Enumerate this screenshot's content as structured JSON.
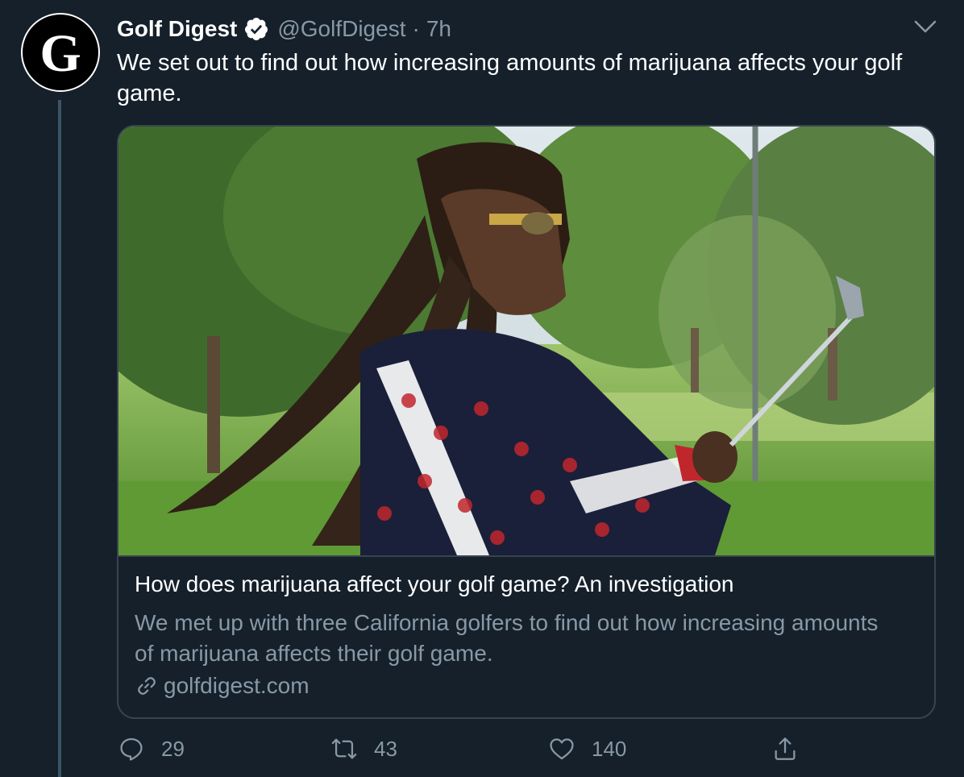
{
  "author": {
    "display_name": "Golf Digest",
    "handle": "@GolfDigest",
    "separator": "·",
    "time": "7h",
    "avatar_letter": "G",
    "verified": true
  },
  "tweet": {
    "text": "We set out to find out how increasing amounts of marijuana affects your golf game."
  },
  "card": {
    "image_description": "Photo of a golfer with long dreadlocks in a patterned tracksuit holding a golf club on a course",
    "title": "How does marijuana affect your golf game? An investigation",
    "description": "We met up with three California golfers to find out how increasing amounts of marijuana affects their golf game.",
    "domain": "golfdigest.com"
  },
  "actions": {
    "reply": {
      "icon": "reply-icon",
      "count": "29"
    },
    "retweet": {
      "icon": "retweet-icon",
      "count": "43"
    },
    "like": {
      "icon": "heart-icon",
      "count": "140"
    },
    "share": {
      "icon": "share-icon"
    }
  },
  "colors": {
    "background": "#15202b",
    "text_primary": "#ffffff",
    "text_secondary": "#8899a6",
    "border": "#38444d"
  }
}
